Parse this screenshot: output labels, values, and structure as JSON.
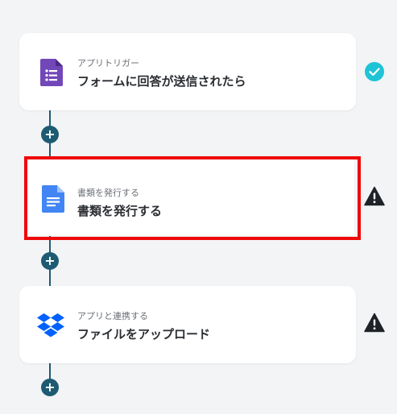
{
  "flow": {
    "steps": [
      {
        "subtitle": "アプリトリガー",
        "title": "フォームに回答が送信されたら",
        "icon": "google-forms-icon",
        "status": "check-circle-icon",
        "status_color": "#1fc3d6"
      },
      {
        "subtitle": "書類を発行する",
        "title": "書類を発行する",
        "icon": "google-docs-icon",
        "status": "warning-icon",
        "status_color": "#1f2328",
        "selected": true
      },
      {
        "subtitle": "アプリと連携する",
        "title": "ファイルをアップロード",
        "icon": "dropbox-icon",
        "status": "warning-icon",
        "status_color": "#1f2328"
      }
    ],
    "add_step_label": "+"
  },
  "colors": {
    "connector": "#1e5b73",
    "selection": "#ee0a0a",
    "forms_purple": "#7248b9",
    "docs_blue": "#4285f4",
    "dropbox_blue": "#0061fe"
  }
}
